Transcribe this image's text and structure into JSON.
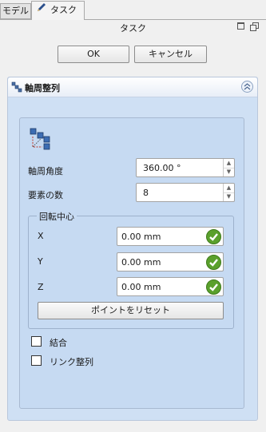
{
  "tabs": [
    {
      "label": "モデル",
      "icon": "none"
    },
    {
      "label": "タスク",
      "icon": "pencil-icon"
    }
  ],
  "panel": {
    "title": "タスク"
  },
  "buttons": {
    "ok": "OK",
    "cancel": "キャンセル"
  },
  "section": {
    "title": "軸周整列",
    "fields": {
      "angle_label": "軸周角度",
      "angle_value": "360.00 °",
      "count_label": "要素の数",
      "count_value": "8"
    },
    "center": {
      "title": "回転中心",
      "x_label": "X",
      "x_value": "0.00 mm",
      "y_label": "Y",
      "y_value": "0.00 mm",
      "z_label": "Z",
      "z_value": "0.00 mm",
      "reset_label": "ポイントをリセット"
    },
    "options": {
      "combine_label": "結合",
      "combine_checked": false,
      "link_label": "リンク整列",
      "link_checked": false
    }
  },
  "colors": {
    "valid": "#5aa02c",
    "section_bg": "#cfe0f4"
  }
}
